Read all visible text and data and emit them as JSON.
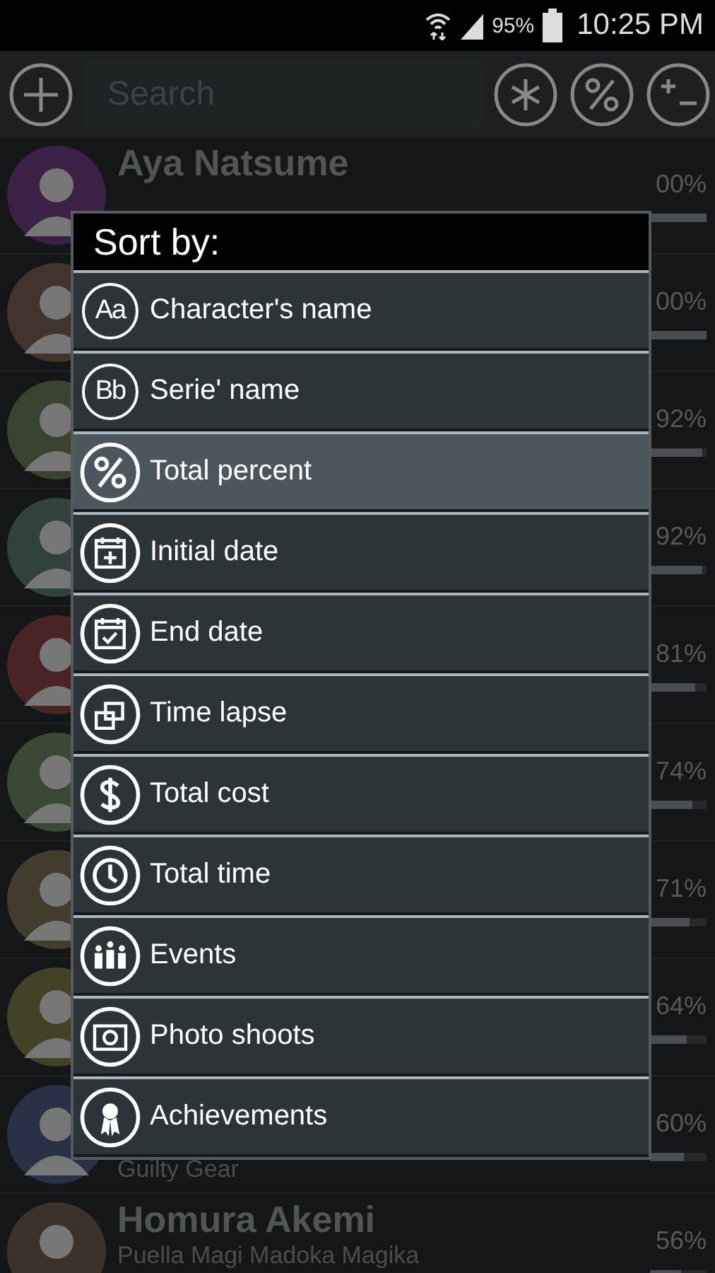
{
  "status_bar": {
    "battery": "95%",
    "time": "10:25 PM"
  },
  "toolbar": {
    "search": {
      "placeholder": "Search"
    }
  },
  "rows": [
    {
      "name": "Aya Natsume",
      "percent": "00%",
      "level": 1.0
    },
    {
      "percent": "00%",
      "level": 1.0
    },
    {
      "percent": "92%",
      "level": 0.92
    },
    {
      "percent": "92%",
      "level": 0.92
    },
    {
      "percent": "81%",
      "level": 0.81
    },
    {
      "percent": "74%",
      "level": 0.74
    },
    {
      "percent": "71%",
      "level": 0.71
    },
    {
      "percent": "64%",
      "level": 0.64
    },
    {
      "subtitle": "Guilty Gear",
      "percent": "60%",
      "level": 0.6
    },
    {
      "name": "Homura Akemi",
      "subtitle": "Puella Magi Madoka Magika",
      "percent": "56%",
      "level": 0.56
    }
  ],
  "dialog": {
    "title": "Sort by:",
    "items": [
      {
        "label": "Character's name",
        "icon_text": "Aa",
        "selected": false
      },
      {
        "label": "Serie' name",
        "icon_text": "Bb",
        "selected": false
      },
      {
        "label": "Total percent",
        "selected": true
      },
      {
        "label": "Initial date",
        "selected": false
      },
      {
        "label": "End date",
        "selected": false
      },
      {
        "label": "Time lapse",
        "selected": false
      },
      {
        "label": "Total cost",
        "selected": false
      },
      {
        "label": "Total time",
        "selected": false
      },
      {
        "label": "Events",
        "selected": false
      },
      {
        "label": "Photo shoots",
        "selected": false
      },
      {
        "label": "Achievements",
        "selected": false
      }
    ]
  }
}
